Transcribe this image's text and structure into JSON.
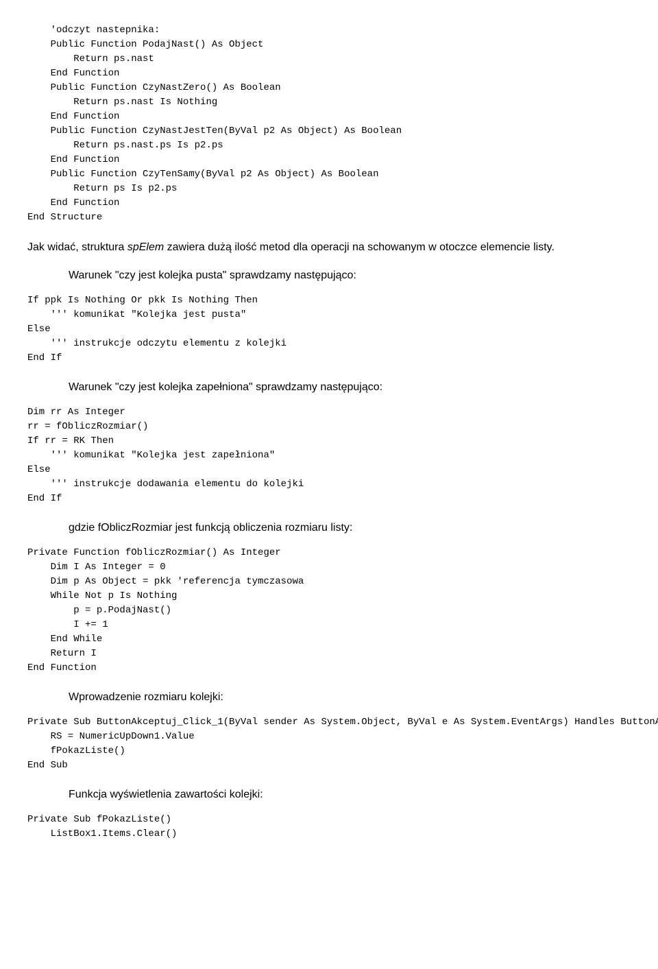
{
  "sections": [
    {
      "type": "code",
      "id": "code-block-1",
      "content": "    'odczyt nastepnika:\n    Public Function PodajNast() As Object\n        Return ps.nast\n    End Function\n    Public Function CzyNastZero() As Boolean\n        Return ps.nast Is Nothing\n    End Function\n    Public Function CzyNastJestTen(ByVal p2 As Object) As Boolean\n        Return ps.nast.ps Is p2.ps\n    End Function\n    Public Function CzyTenSamy(ByVal p2 As Object) As Boolean\n        Return ps Is p2.ps\n    End Function\nEnd Structure"
    },
    {
      "type": "prose",
      "id": "prose-1",
      "content": "Jak widać, struktura spElem zawiera dużą ilość metod dla operacji na schowanym w otoczce elemencie listy.",
      "italic_word": "spElem"
    },
    {
      "type": "heading",
      "id": "heading-1",
      "content": "Warunek \"czy jest kolejka pusta\" sprawdzamy następująco:"
    },
    {
      "type": "code",
      "id": "code-block-2",
      "content": "If ppk Is Nothing Or pkk Is Nothing Then\n    ''' komunikat \"Kolejka jest pusta\"\nElse\n    ''' instrukcje odczytu elementu z kolejki\nEnd If"
    },
    {
      "type": "heading",
      "id": "heading-2",
      "content": "Warunek \"czy jest kolejka zapełniona\" sprawdzamy następująco:"
    },
    {
      "type": "code",
      "id": "code-block-3",
      "content": "Dim rr As Integer\nrr = fObliczRozmiar()\nIf rr = RK Then\n    ''' komunikat \"Kolejka jest zapełniona\"\nElse\n    ''' instrukcje dodawania elementu do kolejki\nEnd If"
    },
    {
      "type": "prose",
      "id": "prose-2",
      "content": "gdzie fObliczRozmiar jest funkcją obliczenia rozmiaru listy:"
    },
    {
      "type": "code",
      "id": "code-block-4",
      "content": "Private Function fObliczRozmiar() As Integer\n    Dim I As Integer = 0\n    Dim p As Object = pkk 'referencja tymczasowa\n    While Not p Is Nothing\n        p = p.PodajNast()\n        I += 1\n    End While\n    Return I\nEnd Function"
    },
    {
      "type": "prose",
      "id": "prose-3",
      "content": "Wprowadzenie rozmiaru kolejki:"
    },
    {
      "type": "code",
      "id": "code-block-5",
      "content": "Private Sub ButtonAkceptuj_Click_1(ByVal sender As System.Object, ByVal e As System.EventArgs) Handles ButtonAkceptuj.Click\n    RS = NumericUpDown1.Value\n    fPokazListe()\nEnd Sub"
    },
    {
      "type": "prose",
      "id": "prose-4",
      "content": "Funkcja wyświetlenia zawartości kolejki:"
    },
    {
      "type": "code",
      "id": "code-block-6",
      "content": "Private Sub fPokazListe()\n    ListBox1.Items.Clear()"
    }
  ]
}
